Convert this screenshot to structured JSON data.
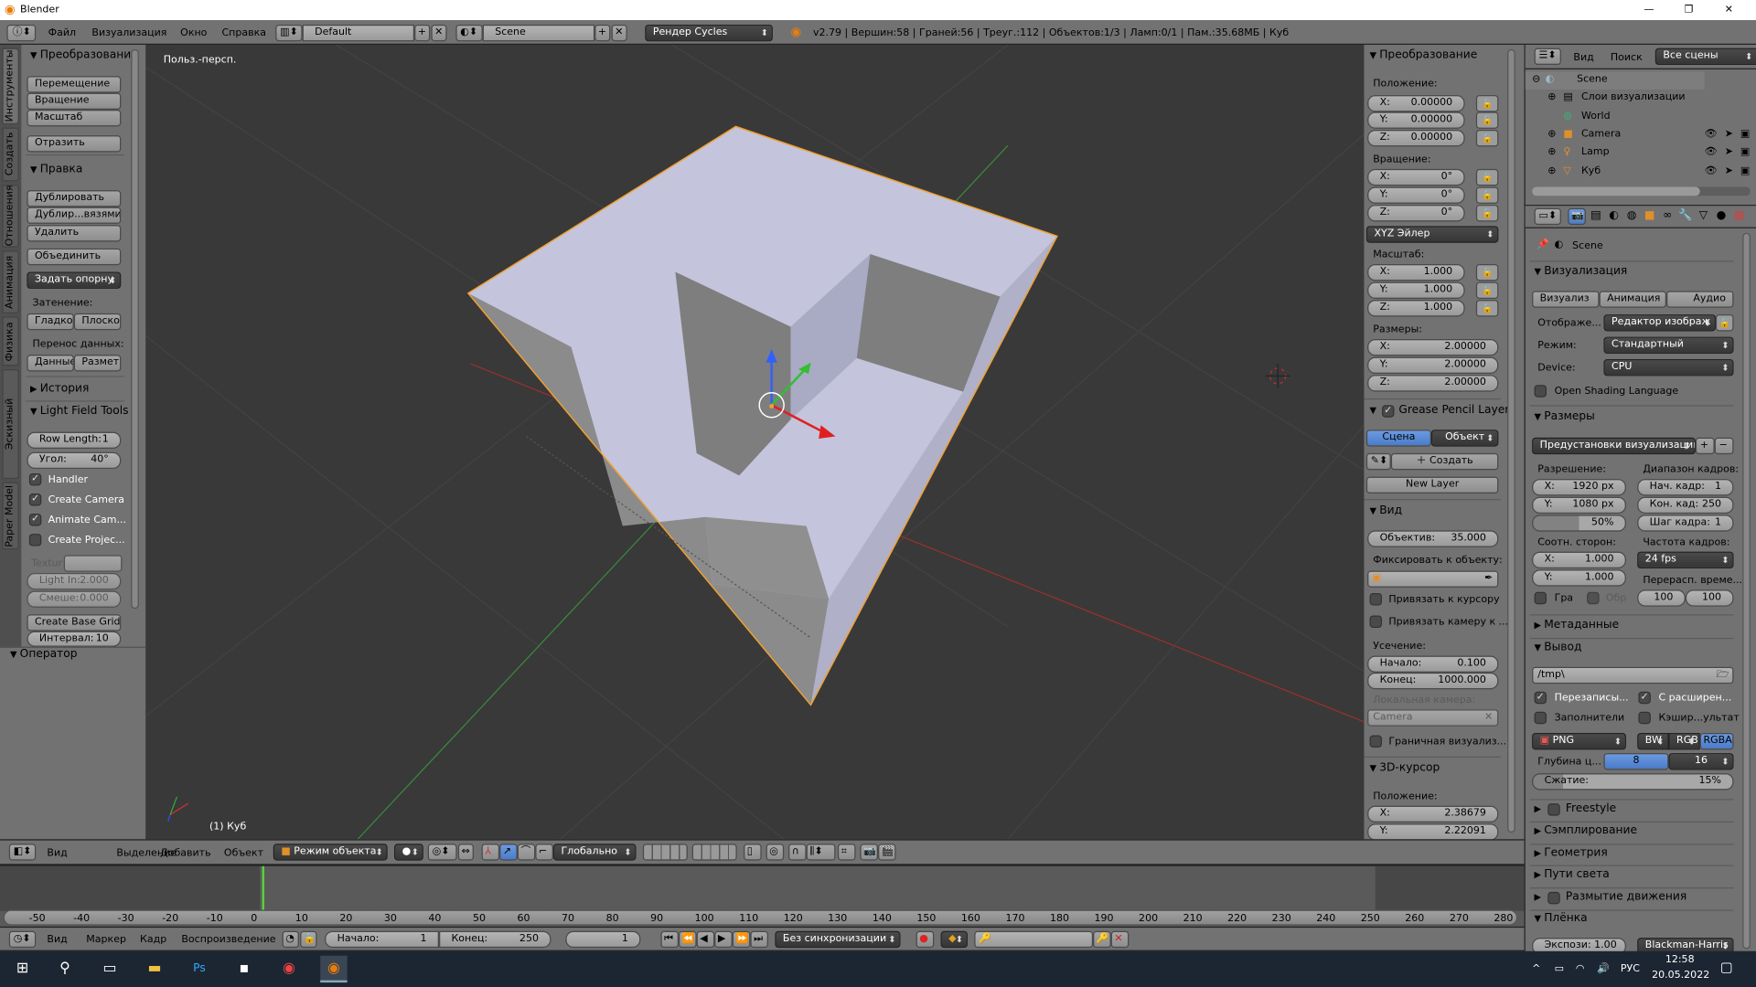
{
  "window": {
    "title": "Blender",
    "controls": [
      "—",
      "❐",
      "✕"
    ]
  },
  "topbar": {
    "menu": [
      "Файл",
      "Визуализация",
      "Окно",
      "Справка"
    ],
    "layout": "Default",
    "scene": "Scene",
    "engine": "Рендер Cycles",
    "stats": "v2.79 | Вершин:58 | Граней:56 | Треуг.:112 | Объектов:1/3 | Ламп:0/1 | Пам.:35.68МБ | Куб"
  },
  "tool_tabs": [
    "Инструменты",
    "Создать",
    "Отношения",
    "Анимация",
    "Физика",
    "Эскизный карандаш",
    "Paper Model"
  ],
  "tools": {
    "transform": {
      "title": "Преобразовани",
      "buttons": [
        "Перемещение",
        "Вращение",
        "Масштаб",
        "Отразить"
      ]
    },
    "edit": {
      "title": "Правка",
      "buttons": [
        "Дублировать",
        "Дублир...вязями",
        "Удалить",
        "Объединить"
      ],
      "pivot": "Задать опорну",
      "shading_label": "Затенение:",
      "smooth": "Гладко",
      "flat": "Плоско",
      "transfer_label": "Перенос данных:",
      "data": "Данные",
      "layout": "Разметк"
    },
    "history": "История",
    "lft": {
      "title": "Light Field Tools",
      "row_length_label": "Row Length:",
      "row_length": "1",
      "angle_label": "Угол:",
      "angle": "40°",
      "checks": [
        {
          "label": "Handler",
          "checked": true
        },
        {
          "label": "Create Camera",
          "checked": true
        },
        {
          "label": "Animate Cam...",
          "checked": true
        },
        {
          "label": "Create Projec...",
          "checked": false
        }
      ],
      "texture_label": "Textur",
      "light_in_label": "Light In:",
      "light_in": "2.000",
      "blend_label": "Смеше:",
      "blend": "0.000",
      "base_grid": "Create Base Grid",
      "interval_label": "Интервал:",
      "interval": "10"
    },
    "operator": "Оператор"
  },
  "viewport": {
    "view_name": "Польз.-персп.",
    "object_info": "(1) Куб",
    "colors": {
      "bg": "#393939",
      "cube_light": "#c4c5dc",
      "cube_gray": "#8c8c8c",
      "outline": "#f0a030",
      "x_axis": "#c03030",
      "y_axis": "#309030"
    }
  },
  "npanel": {
    "transform": "Преобразование",
    "location": "Положение:",
    "loc": [
      "0.00000",
      "0.00000",
      "0.00000"
    ],
    "rotation": "Вращение:",
    "rot": [
      "0°",
      "0°",
      "0°"
    ],
    "rot_mode": "XYZ Эйлер",
    "scale": "Масштаб:",
    "scl": [
      "1.000",
      "1.000",
      "1.000"
    ],
    "dims": "Размеры:",
    "dim": [
      "2.00000",
      "2.00000",
      "2.00000"
    ],
    "axes": [
      "X:",
      "Y:",
      "Z:"
    ],
    "gp": {
      "title": "Grease Pencil Layers",
      "scene": "Сцена",
      "object": "Объект",
      "create": "Создать",
      "new_layer": "New Layer"
    },
    "view": {
      "title": "Вид",
      "lens_label": "Объектив:",
      "lens": "35.000",
      "lock_obj": "Фиксировать к объекту:",
      "lock_cursor": "Привязать к курсору",
      "lock_cam": "Привязать камеру к ...",
      "clip": "Усечение:",
      "start_label": "Начало:",
      "start": "0.100",
      "end_label": "Конец:",
      "end": "1000.000",
      "local_cam": "Локальная камера:",
      "camera": "Camera",
      "border": "Граничная визуализ..."
    },
    "cursor": {
      "title": "3D-курсор",
      "location": "Положение:",
      "x": "2.38679",
      "y": "2.22091"
    }
  },
  "outliner": {
    "view": "Вид",
    "search": "Поиск",
    "filter": "Все сцены",
    "items": [
      {
        "label": "Scene"
      },
      {
        "label": "Слои визуализации"
      },
      {
        "label": "World"
      },
      {
        "label": "Camera"
      },
      {
        "label": "Lamp"
      },
      {
        "label": "Куб"
      }
    ]
  },
  "properties": {
    "context": "Scene",
    "render": {
      "title": "Визуализация",
      "tabs": [
        "Визуализ",
        "Анимация",
        "Аудио"
      ],
      "display_label": "Отображе...",
      "display": "Редактор изображ",
      "mode_label": "Режим:",
      "mode": "Стандартный",
      "device_label": "Device:",
      "device": "CPU",
      "osl": "Open Shading Language"
    },
    "dims": {
      "title": "Размеры",
      "presets": "Предустановки визуализации",
      "res_label": "Разрешение:",
      "res_x": "1920 px",
      "res_y": "1080 px",
      "res_pct": "50%",
      "res_pct_value": 50,
      "range_label": "Диапазон кадров:",
      "start_label": "Нач. кадр:",
      "start": "1",
      "end_label": "Кон. кад:",
      "end": "250",
      "step_label": "Шаг кадра:",
      "step": "1",
      "aspect_label": "Соотн. сторон:",
      "aspect_x": "1.000",
      "aspect_y": "1.000",
      "fps_label": "Частота кадров:",
      "fps": "24 fps",
      "remap_label": "Перерасп. време...",
      "remap_old": "100",
      "remap_new": "100",
      "border": "Гра",
      "crop": "Обр"
    },
    "metadata": "Метаданные",
    "output": {
      "title": "Вывод",
      "path": "/tmp\\",
      "overwrite": "Перезаписы...",
      "extension": "С расширен...",
      "placeholders": "Заполнители",
      "cache": "Кэшир...ультат",
      "format": "PNG",
      "bw": "BW",
      "rgb": "RGB",
      "rgba": "RGBA",
      "depth_label": "Глубина ц...",
      "d8": "8",
      "d16": "16",
      "compression_label": "Сжатие:",
      "compression": "15%",
      "compression_value": 15
    },
    "collapsed": [
      "Freestyle",
      "Сэмплирование",
      "Геометрия",
      "Пути света",
      "Размытие движения"
    ],
    "film": {
      "title": "Плёнка",
      "exposure": "Экспози: 1.00",
      "filter": "Blackman-Harris"
    }
  },
  "view3d_header": {
    "menus": [
      "Вид",
      "Выделение",
      "Добавить",
      "Объект"
    ],
    "mode": "Режим объекта",
    "orientation": "Глобально"
  },
  "timeline": {
    "ticks": [
      -50,
      -40,
      -30,
      -20,
      -10,
      0,
      10,
      20,
      30,
      40,
      50,
      60,
      70,
      80,
      90,
      100,
      110,
      120,
      130,
      140,
      150,
      160,
      170,
      180,
      190,
      200,
      210,
      220,
      230,
      240,
      250,
      260,
      270,
      280
    ],
    "current_frame": 1,
    "menus": [
      "Вид",
      "Маркер",
      "Кадр",
      "Воспроизведение"
    ],
    "start_label": "Начало:",
    "start": "1",
    "end_label": "Конец:",
    "end": "250",
    "frame": "1",
    "sync": "Без синхронизации"
  },
  "taskbar": {
    "lang": "РУС",
    "time": "12:58",
    "date": "20.05.2022"
  }
}
